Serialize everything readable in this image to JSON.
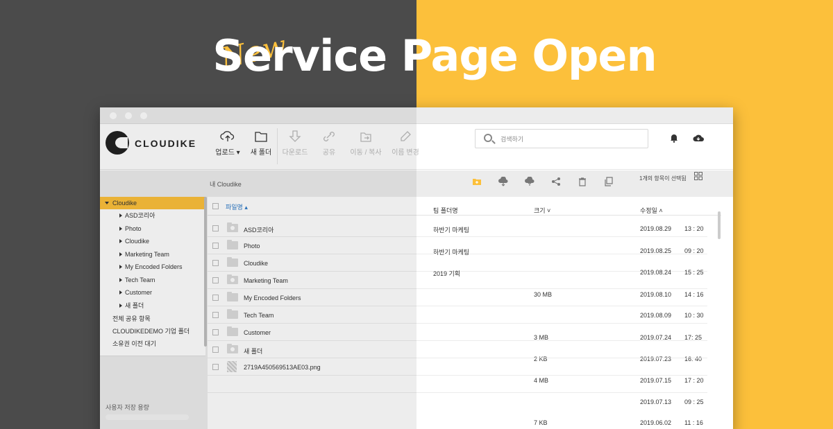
{
  "banner": {
    "new_word": "New",
    "title": "Service Page Open"
  },
  "colors": {
    "accent": "#fcc03b",
    "dark_bg": "#4b4b4b"
  },
  "app": {
    "logo_text": "CLOUDIKE"
  },
  "toolbar": {
    "upload_label": "업로드 ▾",
    "new_folder_label": "새 폴더",
    "download_label": "다운로드",
    "share_label": "공유",
    "move_copy_label": "이동 / 복사",
    "rename_label": "이름 변경"
  },
  "search": {
    "placeholder": "검색하기"
  },
  "icons": [
    "search-icon",
    "bell-icon",
    "cloud-icon",
    "upload-icon",
    "folder-icon",
    "download-icon",
    "link-icon",
    "move-icon",
    "pencil-icon",
    "new-folder-icon",
    "cloud-upload-icon",
    "cloud-download-icon",
    "share-icon",
    "trash-icon",
    "copy-icon",
    "grid-icon"
  ],
  "breadcrumb": "내 Cloudike",
  "selection_text": "1개의 항목이 선택됨",
  "sidebar": {
    "root": "Cloudike",
    "children": [
      "ASD코리아",
      "Photo",
      "Cloudike",
      "Marketing Team",
      "My Encoded Folders",
      "Tech Team",
      "Customer",
      "새 폴더"
    ],
    "extra": [
      "전체 공유 항목",
      "CLOUDIKEDEMO 기업 폴더",
      "소유권 이전 대기"
    ],
    "storage_label": "사용자 저장 용량"
  },
  "columns": {
    "name": "파일명 ▴",
    "team": "팀 폴더명",
    "size": "크기 ˅",
    "modified": "수정일 ˄"
  },
  "rows": [
    {
      "name": "ASD코리아",
      "team": "하반기 마케팅",
      "size": "",
      "date": "2019.08.29",
      "time": "13 : 20",
      "icon": "shared"
    },
    {
      "name": "Photo",
      "team": "하반기 마케팅",
      "size": "",
      "date": "2019.08.25",
      "time": "09 : 20",
      "icon": "folder"
    },
    {
      "name": "Cloudike",
      "team": "2019 기획",
      "size": "",
      "date": "2019.08.24",
      "time": "15 : 25",
      "icon": "folder"
    },
    {
      "name": "Marketing Team",
      "team": "",
      "size": "30 MB",
      "date": "2019.08.10",
      "time": "14 : 16",
      "icon": "shared"
    },
    {
      "name": "My Encoded Folders",
      "team": "",
      "size": "",
      "date": "2019.08.09",
      "time": "10 : 30",
      "icon": "folder"
    },
    {
      "name": "Tech Team",
      "team": "",
      "size": "3 MB",
      "date": "2019.07.24",
      "time": "17: 25",
      "icon": "folder"
    },
    {
      "name": "Customer",
      "team": "",
      "size": "2 KB",
      "date": "2019.07.23",
      "time": "16: 40",
      "icon": "folder"
    },
    {
      "name": "새 폴더",
      "team": "",
      "size": "4 MB",
      "date": "2019.07.15",
      "time": "17 : 20",
      "icon": "shared"
    },
    {
      "name": "2719A450569513AE03.png",
      "team": "",
      "size": "",
      "date": "2019.07.13",
      "time": "09 : 25",
      "icon": "image"
    },
    {
      "name": "",
      "team": "",
      "size": "7 KB",
      "date": "2019.06.02",
      "time": "11 : 16",
      "icon": "none"
    }
  ]
}
